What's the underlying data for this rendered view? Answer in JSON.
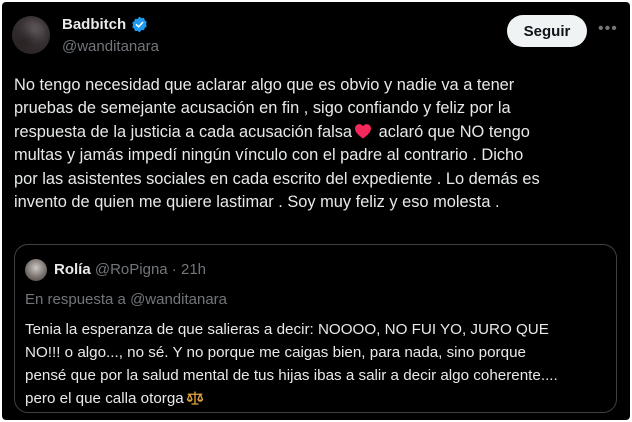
{
  "author": {
    "display_name": "Badbitch",
    "handle": "@wanditanara",
    "verified_icon": "verified-badge-icon",
    "avatar": "profile-photo"
  },
  "actions": {
    "follow_label": "Seguir",
    "more_icon": "more-options-icon"
  },
  "tweet": {
    "text_part1": "No tengo necesidad que aclarar algo que es obvio y nadie va a tener\npruebas de semejante acusación  en fin , sigo confiando y feliz por la\nrespuesta de la justicia a cada acusación falsa",
    "emoji": "red-heart-icon",
    "text_part2": " aclaró que NO tengo\nmultas y jamás impedí ningún vínculo con el padre al contrario .  Dicho\npor las asistentes sociales en cada escrito del expediente . Lo demás es\ninvento de quien me quiere lastimar . Soy muy feliz y eso molesta ."
  },
  "quoted": {
    "display_name": "Rolía",
    "handle": "@RoPigna",
    "separator": " · ",
    "time": "21h",
    "reply_to": "En respuesta a @wanditanara",
    "text": "Tenia la esperanza de que salieras a decir: NOOOO, NO FUI YO, JURO QUE\nNO!!! o algo..., no sé.  Y no porque me caigas bien, para nada, sino porque\npensé que por la salud mental de tus hijas ibas a salir a decir algo coherente....\npero el que calla otorga",
    "emoji": "balance-scale-icon"
  },
  "colors": {
    "background": "#000000",
    "primary_text": "#e7e9ea",
    "secondary_text": "#71767b",
    "verified_blue": "#1d9bf0",
    "follow_button_bg": "#eff3f4",
    "border": "#3e4144",
    "heart": "#f91880"
  }
}
